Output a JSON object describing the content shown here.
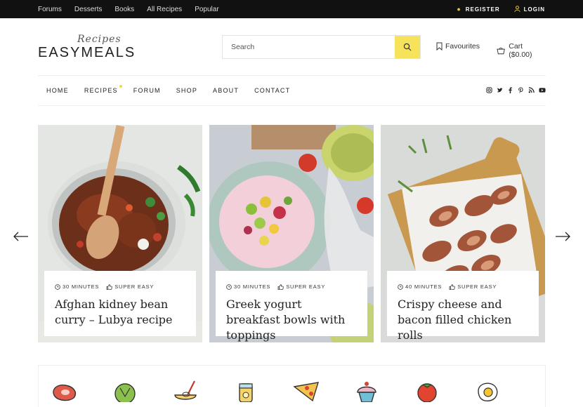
{
  "topbar": {
    "links": [
      "Forums",
      "Desserts",
      "Books",
      "All Recipes",
      "Popular"
    ],
    "register": "REGISTER",
    "login": "LOGIN"
  },
  "logo": {
    "script": "Recipes",
    "word": "EASYMEALS"
  },
  "search": {
    "placeholder": "Search"
  },
  "header": {
    "favourites": "Favourites",
    "cart": "Cart ($0.00)"
  },
  "nav": [
    "HOME",
    "RECIPES",
    "FORUM",
    "SHOP",
    "ABOUT",
    "CONTACT"
  ],
  "social": [
    "instagram-icon",
    "twitter-icon",
    "facebook-icon",
    "pinterest-icon",
    "rss-icon",
    "youtube-icon"
  ],
  "cards": [
    {
      "time": "30 MINUTES",
      "difficulty": "SUPER EASY",
      "title": "Afghan kidney bean curry – Lubya recipe"
    },
    {
      "time": "30 MINUTES",
      "difficulty": "SUPER EASY",
      "title": "Greek yogurt breakfast bowls with toppings"
    },
    {
      "time": "40 MINUTES",
      "difficulty": "SUPER EASY",
      "title": "Crispy cheese and bacon filled chicken rolls"
    }
  ],
  "categories": [
    "steak-icon",
    "lettuce-icon",
    "bowl-whisk-icon",
    "lemonade-jar-icon",
    "pizza-slice-icon",
    "cupcake-icon",
    "tomato-icon",
    "fried-egg-icon"
  ],
  "colors": {
    "accent": "#f7e35b",
    "topbar": "#111111"
  }
}
